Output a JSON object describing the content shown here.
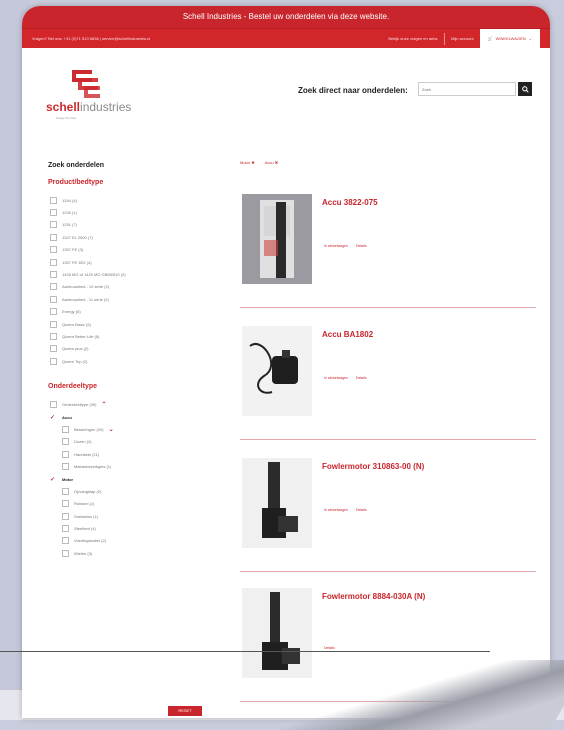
{
  "topbar": {
    "message": "Schell Industries - Bestel uw onderdelen via deze website."
  },
  "subbar": {
    "contact": "Vragen? Bel ons: +31 (0)71 513 6838 | service@schellindustries.nl",
    "link1": "Bekijk onze vragen en antw.",
    "link2": "Mijn account",
    "cart": "WINKELWAGEN"
  },
  "logo": {
    "brand_bold": "schell",
    "brand_thin": "industries",
    "tagline": "simply the best"
  },
  "search": {
    "label": "Zoek direct naar onderdelen:",
    "placeholder": "Zoek"
  },
  "sidebar": {
    "title": "Zoek onderdelen",
    "section1": "Product/bedtype",
    "bedtypes": [
      "1244 (4)",
      "1245 (1)",
      "1251 (7)",
      "1327 EL 2500 (7)",
      "1357 FE (3)",
      "1357 FE 3EZ (4)",
      "1425 MO of 1425 MO GB55/510 (2)",
      "Aanbouwbed - 10 serie (2)",
      "Aanbouwbed - 11 serie (2)",
      "Energy (6)",
      "Queen Basic (5)",
      "Queen Better Life (5)",
      "Queen plus (2)",
      "Queen Top (2)"
    ],
    "section2": "Onderdeeltype",
    "parts_root": "Onderdeeltype (39)",
    "parts": [
      {
        "label": "Accu",
        "level": 1,
        "checked": true
      },
      {
        "label": "Besturingen (20)",
        "level": 2,
        "expand": true
      },
      {
        "label": "Dozen (4)",
        "level": 2
      },
      {
        "label": "Handsets (21)",
        "level": 2
      },
      {
        "label": "Matrasbeveiligers (1)",
        "level": 2
      },
      {
        "label": "Motor",
        "level": 1,
        "checked": true
      },
      {
        "label": "Opvangklap (2)",
        "level": 2
      },
      {
        "label": "Rolstoel (1)",
        "level": 2
      },
      {
        "label": "Snelweiss (1)",
        "level": 2
      },
      {
        "label": "Steelbed (4)",
        "level": 2
      },
      {
        "label": "Voedingskabel (2)",
        "level": 2
      },
      {
        "label": "Wielen (3)",
        "level": 2
      }
    ],
    "reset": "RESET"
  },
  "breadcrumb": [
    "Motor ✖",
    "Accu ✖"
  ],
  "products": [
    {
      "title": "Accu 3822-075",
      "link1": "In winkelwagen",
      "link2": "Details"
    },
    {
      "title": "Accu BA1802",
      "link1": "In winkelwagen",
      "link2": "Details"
    },
    {
      "title": "Fowlermotor 310863-00 (N)",
      "link1": "In winkelwagen",
      "link2": "Details"
    },
    {
      "title": "Fowlermotor 8884-030A (N)",
      "link1": "",
      "link2": "Details"
    }
  ],
  "colors": {
    "brand": "#c8262c",
    "text": "#222222"
  }
}
